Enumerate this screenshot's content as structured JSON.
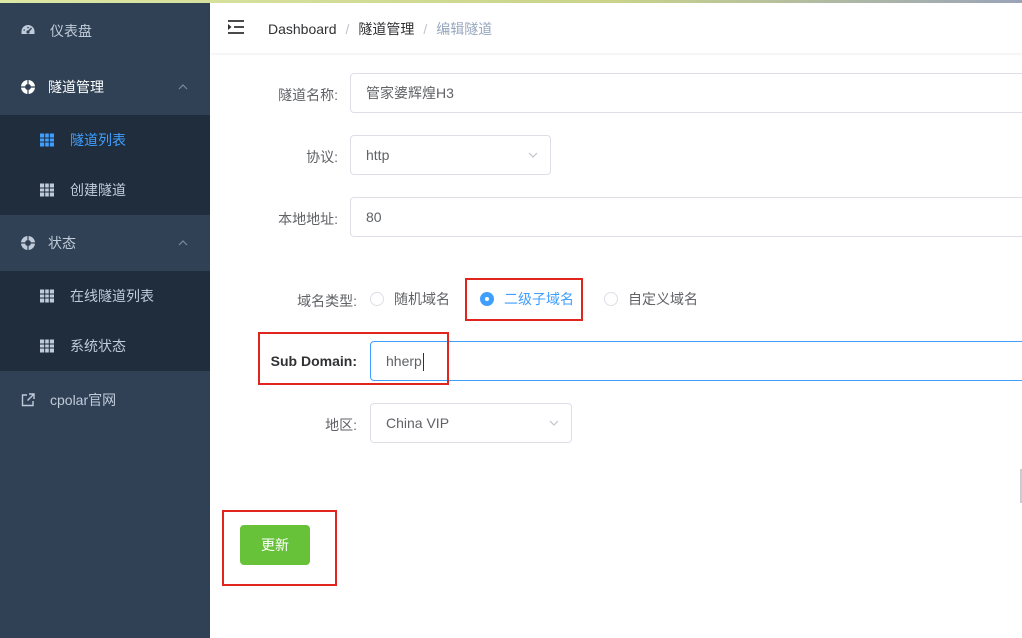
{
  "sidebar": {
    "dashboard": {
      "label": "仪表盘",
      "icon": "dashboard-icon"
    },
    "tunnel_mgmt": {
      "label": "隧道管理",
      "icon": "lifebuoy-icon",
      "items": [
        {
          "label": "隧道列表",
          "icon": "grid-icon",
          "active": true
        },
        {
          "label": "创建隧道",
          "icon": "grid-icon"
        }
      ]
    },
    "status": {
      "label": "状态",
      "icon": "lifebuoy-icon",
      "items": [
        {
          "label": "在线隧道列表",
          "icon": "grid-icon"
        },
        {
          "label": "系统状态",
          "icon": "grid-icon"
        }
      ]
    },
    "cpolar": {
      "label": "cpolar官网",
      "icon": "external-link-icon"
    }
  },
  "header": {
    "breadcrumb": [
      "Dashboard",
      "隧道管理",
      "编辑隧道"
    ],
    "separator": "/"
  },
  "form": {
    "tunnel_name": {
      "label": "隧道名称:",
      "value": "管家婆辉煌H3"
    },
    "protocol": {
      "label": "协议:",
      "value": "http"
    },
    "local_address": {
      "label": "本地地址:",
      "value": "80"
    },
    "domain_type": {
      "label": "域名类型:",
      "options": [
        "随机域名",
        "二级子域名",
        "自定义域名"
      ],
      "selected": "二级子域名"
    },
    "sub_domain": {
      "label": "Sub Domain:",
      "value": "hherp"
    },
    "region": {
      "label": "地区:",
      "value": "China VIP"
    },
    "submit_label": "更新"
  },
  "colors": {
    "sidebar_bg": "#304156",
    "submenu_bg": "#1f2d3d",
    "accent": "#409eff",
    "success": "#67c23a",
    "highlight": "#e0251c"
  }
}
